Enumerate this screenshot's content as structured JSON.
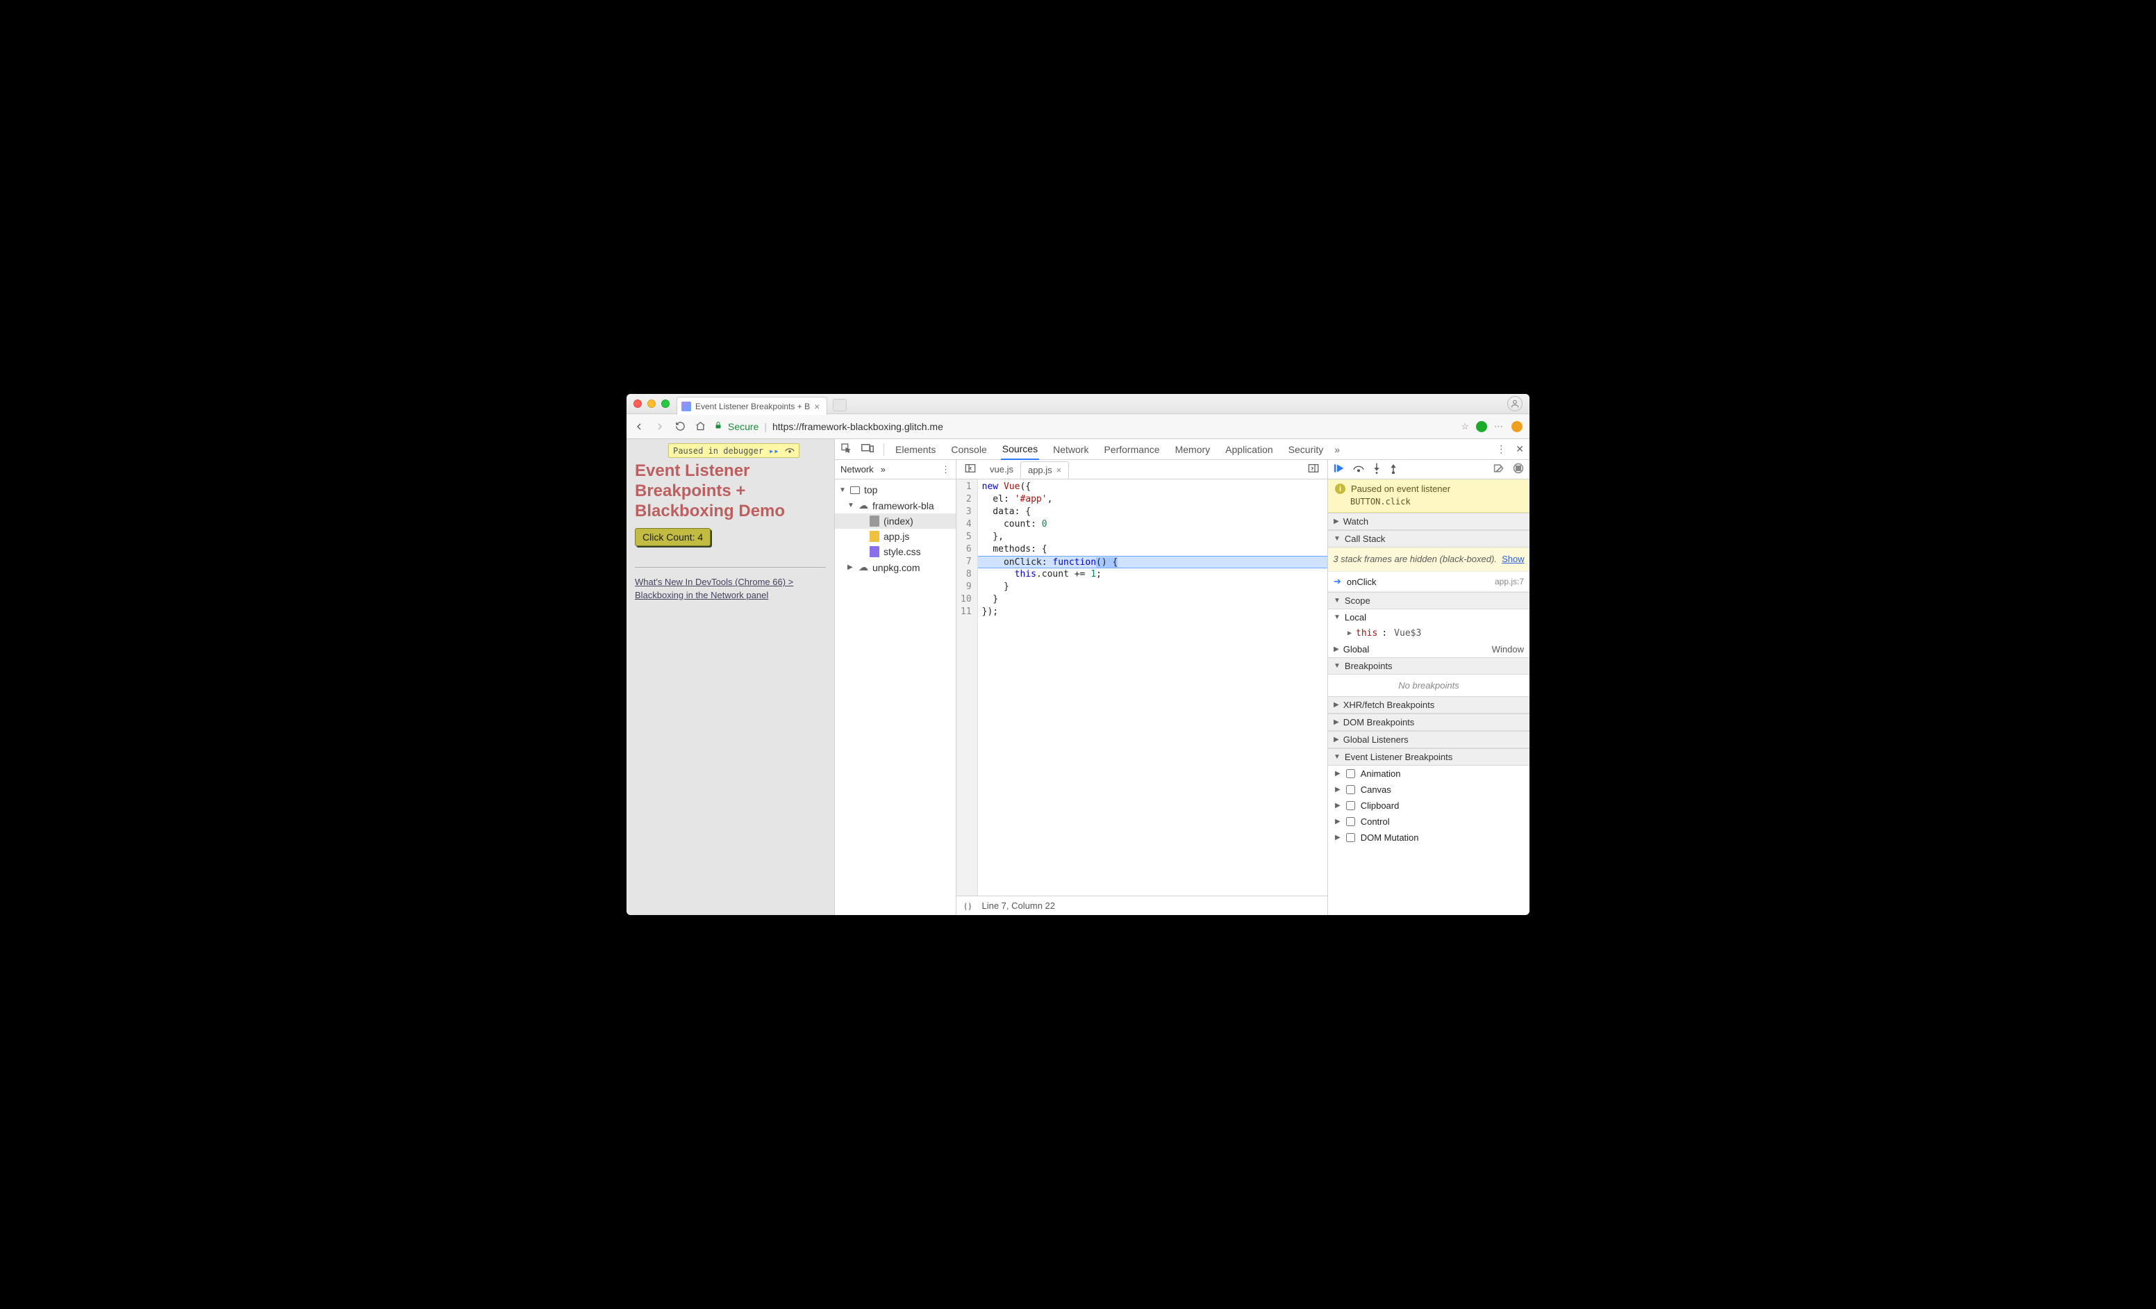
{
  "browser_tab": {
    "title": "Event Listener Breakpoints + B"
  },
  "omnibar": {
    "secure_label": "Secure",
    "url_host": "https://framework-blackboxing.glitch.me",
    "url_path": ""
  },
  "page": {
    "paused_label": "Paused in debugger",
    "heading": "Event Listener Breakpoints + Blackboxing Demo",
    "button_label": "Click Count: 4",
    "whatsnew_link": "What's New In DevTools (Chrome 66) > Blackboxing in the Network panel"
  },
  "devtools": {
    "tabs": [
      "Elements",
      "Console",
      "Sources",
      "Network",
      "Performance",
      "Memory",
      "Application",
      "Security"
    ],
    "active_tab": "Sources"
  },
  "navigator": {
    "header_tab": "Network",
    "top_frame": "top",
    "domain": "framework-bla",
    "files": [
      {
        "name": "(index)",
        "kind": "doc",
        "selected": true
      },
      {
        "name": "app.js",
        "kind": "js",
        "selected": false
      },
      {
        "name": "style.css",
        "kind": "css",
        "selected": false
      }
    ],
    "external_domain": "unpkg.com"
  },
  "editor": {
    "open_tabs": [
      "vue.js",
      "app.js"
    ],
    "active_tab": "app.js",
    "code_lines": [
      "new Vue({",
      "  el: '#app',",
      "  data: {",
      "    count: 0",
      "  },",
      "  methods: {",
      "    onClick: function() {",
      "      this.count += 1;",
      "    }",
      "  }",
      "});"
    ],
    "highlight_line": 7,
    "status": "Line 7, Column 22"
  },
  "debugger": {
    "pause_banner_title": "Paused on event listener",
    "pause_banner_detail": "BUTTON.click",
    "sections": {
      "watch": "Watch",
      "call_stack": "Call Stack",
      "scope": "Scope",
      "breakpoints": "Breakpoints",
      "xhr": "XHR/fetch Breakpoints",
      "dom": "DOM Breakpoints",
      "global_listeners": "Global Listeners",
      "elb": "Event Listener Breakpoints"
    },
    "callstack_hidden_note_prefix": "3 stack frames are hidden (black-boxed).",
    "callstack_hidden_show": "Show",
    "stack_frame": {
      "name": "onClick",
      "location": "app.js:7"
    },
    "scope": {
      "local_label": "Local",
      "this_label": "this",
      "this_value": "Vue$3",
      "global_label": "Global",
      "global_value": "Window"
    },
    "no_breakpoints": "No breakpoints",
    "elb_categories": [
      "Animation",
      "Canvas",
      "Clipboard",
      "Control",
      "DOM Mutation"
    ]
  }
}
